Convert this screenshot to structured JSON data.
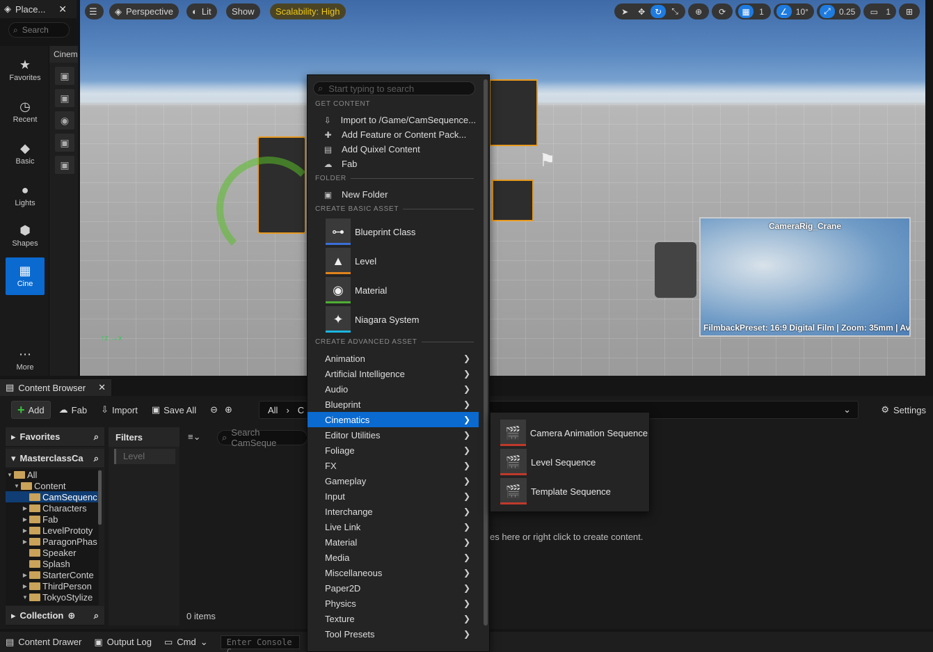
{
  "place_actors": {
    "tab_title": "Place...",
    "search_placeholder": "Search",
    "categories": [
      {
        "label": "Favorites",
        "icon": "star-icon"
      },
      {
        "label": "Recent",
        "icon": "clock-icon"
      },
      {
        "label": "Basic",
        "icon": "basic-shapes-icon"
      },
      {
        "label": "Lights",
        "icon": "light-bulb-icon"
      },
      {
        "label": "Shapes",
        "icon": "cube-icon"
      },
      {
        "label": "Cine",
        "icon": "clapperboard-icon"
      },
      {
        "label": "More",
        "icon": "more-dots-icon"
      }
    ],
    "subpanel_title": "Cinem"
  },
  "viewport": {
    "perspective_label": "Perspective",
    "lit_label": "Lit",
    "show_label": "Show",
    "scalability_label": "Scalability: High",
    "grid_snap": "1",
    "angle_snap": "10°",
    "scale_snap": "0.25",
    "camera_speed": "1",
    "pip_title": "CameraRig_Crane",
    "pip_info": "FilmbackPreset: 16:9 Digital Film | Zoom: 35mm | Av"
  },
  "context_menu": {
    "search_placeholder": "Start typing to search",
    "sections": {
      "get_content": "GET CONTENT",
      "folder": "FOLDER",
      "create_basic": "CREATE BASIC ASSET",
      "create_advanced": "CREATE ADVANCED ASSET"
    },
    "get_content_items": [
      {
        "label": "Import to /Game/CamSequence...",
        "icon": "import-icon"
      },
      {
        "label": "Add Feature or Content Pack...",
        "icon": "feature-pack-icon"
      },
      {
        "label": "Add Quixel Content",
        "icon": "quixel-icon"
      },
      {
        "label": "Fab",
        "icon": "fab-icon"
      }
    ],
    "folder_items": [
      {
        "label": "New Folder",
        "icon": "new-folder-icon"
      }
    ],
    "basic_assets": [
      {
        "label": "Blueprint Class",
        "icon": "blueprint-icon",
        "color": "#3a6fd8"
      },
      {
        "label": "Level",
        "icon": "level-icon",
        "color": "#e0841c"
      },
      {
        "label": "Material",
        "icon": "material-icon",
        "color": "#4fae34"
      },
      {
        "label": "Niagara System",
        "icon": "niagara-icon",
        "color": "#1ab6e0"
      }
    ],
    "advanced_assets": [
      "Animation",
      "Artificial Intelligence",
      "Audio",
      "Blueprint",
      "Cinematics",
      "Editor Utilities",
      "Foliage",
      "FX",
      "Gameplay",
      "Input",
      "Interchange",
      "Live Link",
      "Material",
      "Media",
      "Miscellaneous",
      "Paper2D",
      "Physics",
      "Texture",
      "Tool Presets"
    ],
    "selected_index": 4
  },
  "cinematics_submenu": [
    {
      "label": "Camera Animation Sequence",
      "icon": "clapperboard-icon"
    },
    {
      "label": "Level Sequence",
      "icon": "clapperboard-icon"
    },
    {
      "label": "Template Sequence",
      "icon": "clapperboard-icon"
    }
  ],
  "content_browser": {
    "tab_title": "Content Browser",
    "add_label": "Add",
    "fab_label": "Fab",
    "import_label": "Import",
    "save_all_label": "Save All",
    "path_root": "All",
    "path_next": "C",
    "settings_label": "Settings",
    "favorites_label": "Favorites",
    "project_label": "MasterclassCa",
    "tree": [
      {
        "label": "All",
        "depth": 0,
        "expanded": true
      },
      {
        "label": "Content",
        "depth": 1,
        "expanded": true
      },
      {
        "label": "CamSequenc",
        "depth": 2,
        "selected": true
      },
      {
        "label": "Characters",
        "depth": 2,
        "collapsed": true
      },
      {
        "label": "Fab",
        "depth": 2,
        "collapsed": true
      },
      {
        "label": "LevelPrototy",
        "depth": 2,
        "collapsed": true
      },
      {
        "label": "ParagonPhas",
        "depth": 2,
        "collapsed": true
      },
      {
        "label": "Speaker",
        "depth": 2
      },
      {
        "label": "Splash",
        "depth": 2
      },
      {
        "label": "StarterConte",
        "depth": 2,
        "collapsed": true
      },
      {
        "label": "ThirdPerson",
        "depth": 2,
        "collapsed": true
      },
      {
        "label": "TokyoStylize",
        "depth": 2,
        "expanded": true
      }
    ],
    "collections_label": "Collection",
    "filters_label": "Filters",
    "filter_chip": "Level",
    "search_placeholder": "Search CamSeque",
    "items_count": "0 items",
    "empty_hint": "es here or right click to create content."
  },
  "status_bar": {
    "content_drawer": "Content Drawer",
    "output_log": "Output Log",
    "cmd": "Cmd",
    "console_placeholder": "Enter Console C"
  }
}
